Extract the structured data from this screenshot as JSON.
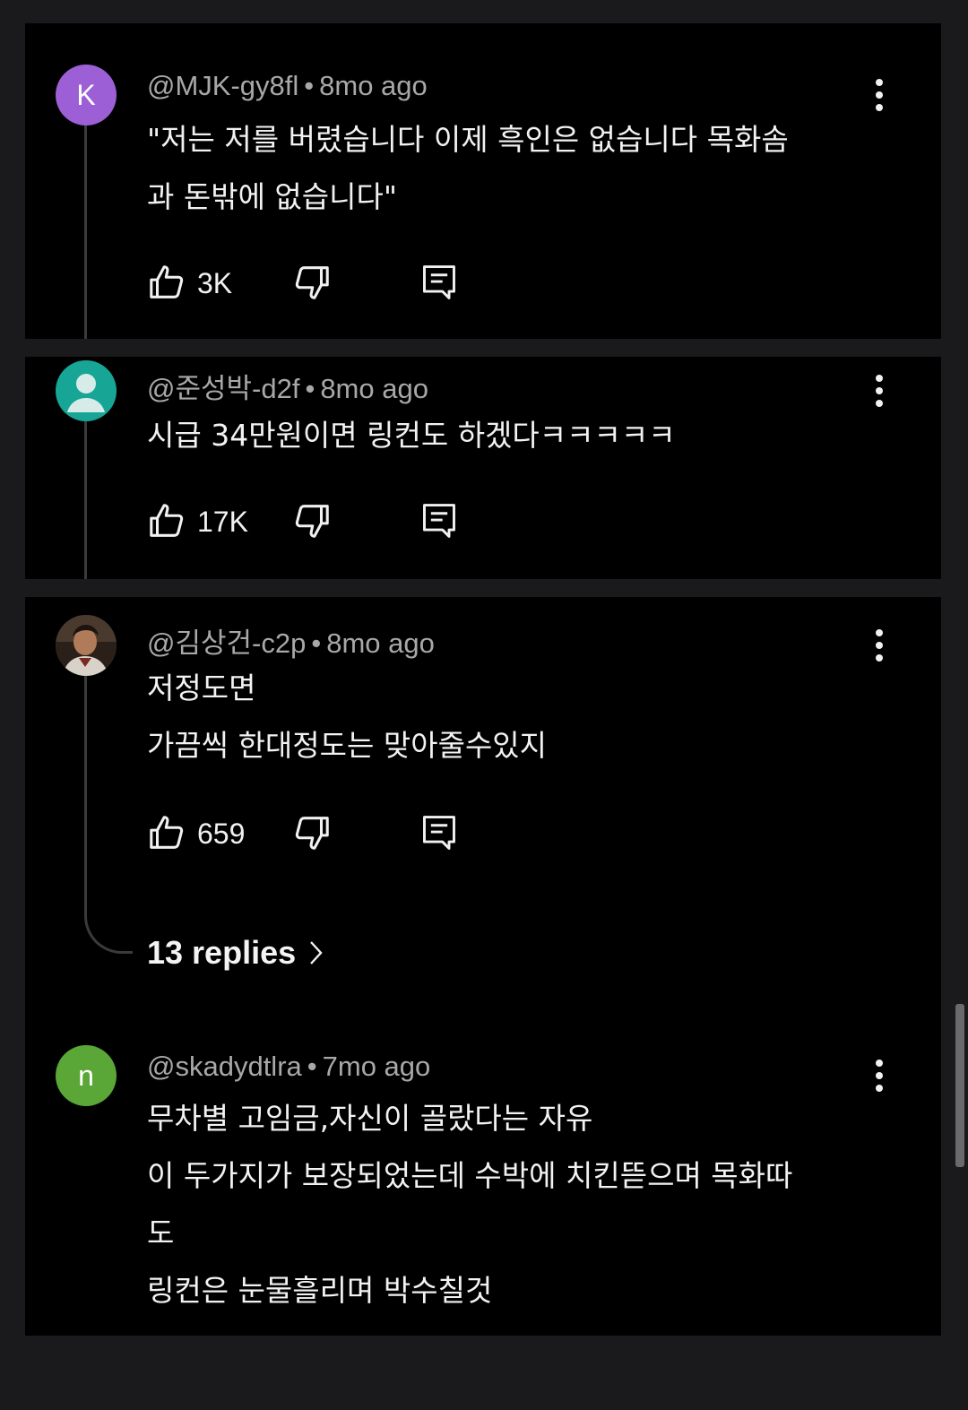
{
  "comments": [
    {
      "avatar_letter": "K",
      "avatar_color": "#9c5fd6",
      "handle": "@MJK-gy8fl",
      "separator": "•",
      "time": "8mo ago",
      "lines": [
        "\"저는 저를 버렸습니다 이제 흑인은 없습니다 목화솜",
        "과 돈밖에 없습니다\""
      ],
      "likes": "3K"
    },
    {
      "avatar_color": "#17a596",
      "handle": "@준성박-d2f",
      "separator": "•",
      "time": "8mo ago",
      "lines": [
        "시급 34만원이면 링컨도 하겠다ㅋㅋㅋㅋㅋ"
      ],
      "likes": "17K"
    },
    {
      "handle": "@김상건-c2p",
      "separator": "•",
      "time": "8mo ago",
      "lines": [
        "저정도면",
        "가끔씩 한대정도는 맞아줄수있지"
      ],
      "likes": "659",
      "replies_label": "13 replies"
    },
    {
      "avatar_letter": "n",
      "avatar_color": "#5aa636",
      "handle": "@skadydtlra",
      "separator": "•",
      "time": "7mo ago",
      "lines": [
        "무차별 고임금,자신이 골랐다는 자유",
        "이 두가지가 보장되었는데 수박에 치킨뜯으며 목화따",
        "도",
        "링컨은 눈물흘리며 박수칠것"
      ]
    }
  ]
}
